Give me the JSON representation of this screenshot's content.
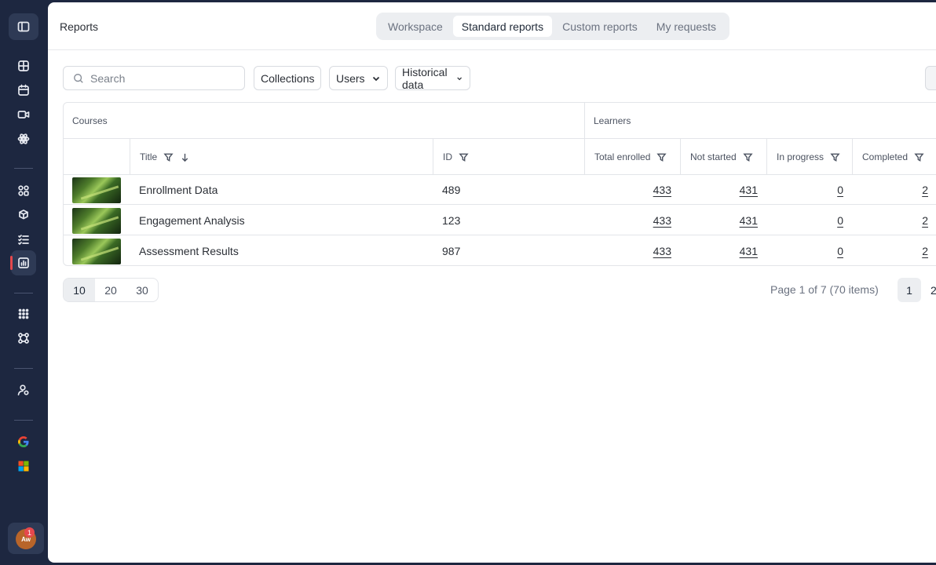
{
  "header": {
    "title": "Reports"
  },
  "tabs": [
    {
      "label": "Workspace"
    },
    {
      "label": "Standard reports"
    },
    {
      "label": "Custom reports"
    },
    {
      "label": "My requests"
    }
  ],
  "filters": {
    "search_placeholder": "Search",
    "collections": "Collections",
    "users": "Users",
    "historical": "Historical data"
  },
  "table": {
    "groups": {
      "courses": "Courses",
      "learners": "Learners"
    },
    "columns": {
      "title": "Title",
      "id": "ID",
      "total": "Total enrolled",
      "not_started": "Not started",
      "in_progress": "In progress",
      "completed": "Completed"
    },
    "rows": [
      {
        "title": "Enrollment Data",
        "id": "489",
        "total": "433",
        "not_started": "431",
        "in_progress": "0",
        "completed": "2"
      },
      {
        "title": "Engagement Analysis",
        "id": "123",
        "total": "433",
        "not_started": "431",
        "in_progress": "0",
        "completed": "2"
      },
      {
        "title": "Assessment Results",
        "id": "987",
        "total": "433",
        "not_started": "431",
        "in_progress": "0",
        "completed": "2"
      }
    ]
  },
  "pagination": {
    "sizes": [
      "10",
      "20",
      "30"
    ],
    "info": "Page 1 of 7 (70 items)",
    "pages": [
      "1",
      "2"
    ]
  },
  "user": {
    "initials": "Aw",
    "notifications": "1"
  },
  "colors": {
    "sidebar": "#1d2740",
    "accent": "#e5484d"
  }
}
